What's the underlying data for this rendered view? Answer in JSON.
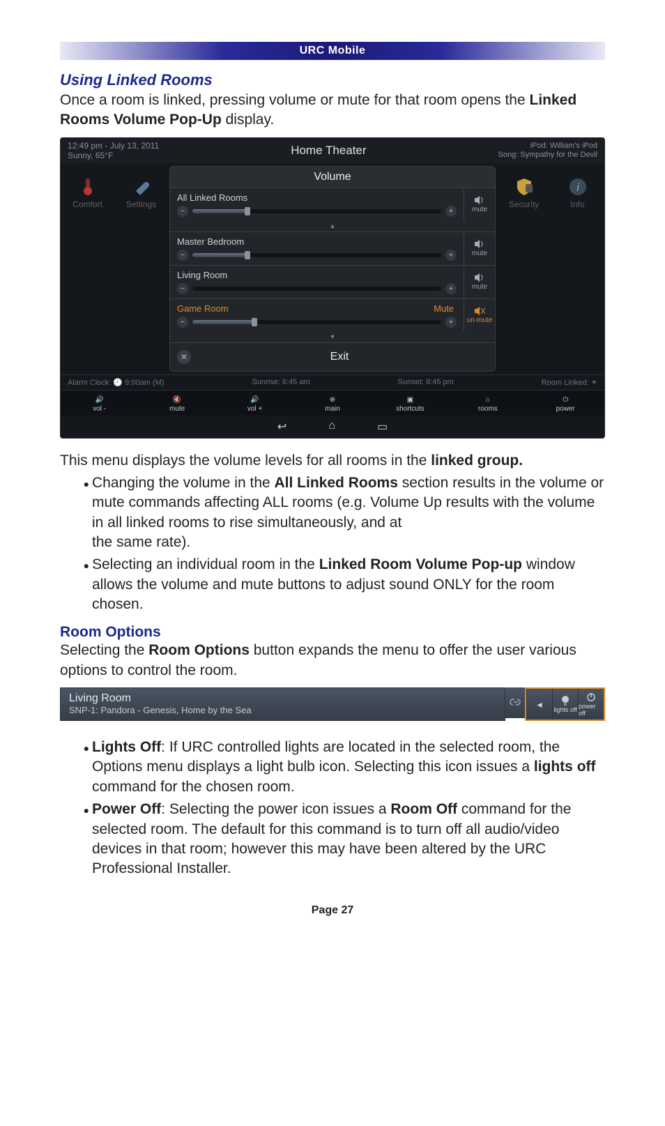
{
  "header": {
    "title": "URC Mobile"
  },
  "section1": {
    "title": "Using Linked Rooms",
    "intro_a": "Once a room is linked, pressing volume or mute for that room opens the ",
    "intro_b": "Linked Rooms Volume Pop-Up",
    "intro_c": " display."
  },
  "app": {
    "top": {
      "time": "12:49 pm - July 13, 2011",
      "weather": "Sunny, 65°F",
      "title": "Home Theater",
      "ipod_label": "iPod:",
      "ipod_value": "William's iPod",
      "song_label": "Song:",
      "song_value": "Sympathy for the Devil"
    },
    "side_left": [
      {
        "name": "Comfort"
      },
      {
        "name": "Settings"
      }
    ],
    "side_right": [
      {
        "name": "Security"
      },
      {
        "name": "Info"
      }
    ],
    "volume": {
      "title": "Volume",
      "rows": [
        {
          "label": "All Linked Rooms",
          "level": 22,
          "mute_text": "mute",
          "muted": false
        },
        {
          "label": "Master Bedroom",
          "level": 22,
          "mute_text": "mute",
          "muted": false
        },
        {
          "label": "Living Room",
          "level": 0,
          "mute_text": "mute",
          "muted": false,
          "plain": true
        },
        {
          "label": "Game Room",
          "level": 25,
          "mute_text": "un-mute",
          "muted": true,
          "orange": true,
          "mute_word": "Mute"
        }
      ],
      "exit": "Exit"
    },
    "status": {
      "alarm_label": "Alarm Clock:",
      "alarm_value": "9:00am (M)",
      "sunrise_label": "Sunrise:",
      "sunrise_value": "6:45 am",
      "sunset_label": "Sunset:",
      "sunset_value": "8:45 pm",
      "linked_label": "Room Linked:"
    },
    "bottom": [
      {
        "label": "vol -"
      },
      {
        "label": "mute"
      },
      {
        "label": "vol +"
      },
      {
        "label": "main"
      },
      {
        "label": "shortcuts"
      },
      {
        "label": "rooms"
      },
      {
        "label": "power"
      }
    ]
  },
  "para2_a": "This menu displays the volume levels for all rooms in the ",
  "para2_b": "linked group.",
  "bullets1": [
    {
      "a": "Changing the volume in the ",
      "b": "All Linked Rooms",
      "c": " section results in the volume or mute commands affecting ALL rooms (e.g. Volume Up results with the volume in all linked rooms to rise simultaneously, and at",
      "d": "the same rate)."
    },
    {
      "a": "Selecting an individual room in the ",
      "b": "Linked Room Volume Pop-up",
      "c": " window allows the volume and mute buttons to adjust sound ONLY for the room chosen."
    }
  ],
  "section2": {
    "title": "Room Options",
    "intro_a": "Selecting the ",
    "intro_b": "Room Options",
    "intro_c": " button expands the menu to offer the user various options to control the room."
  },
  "roombar": {
    "name": "Living Room",
    "sub": "SNP-1: Pandora - Genesis, Home by the Sea",
    "lights": "lights off",
    "power": "power off"
  },
  "bullets2": [
    {
      "t": "Lights Off",
      "body": ": If URC controlled lights are located in the selected room, the Options menu displays a light bulb icon. Selecting this icon issues a ",
      "b2": "lights off",
      "tail": " command for the chosen room."
    },
    {
      "t": "Power Off",
      "body": ": Selecting the power icon issues a ",
      "b2": "Room Off",
      "tail": " command for the selected room. The default for this command is to turn off all audio/video devices in that room; however this may have been altered by the URC Professional Installer."
    }
  ],
  "footer": "Page 27"
}
